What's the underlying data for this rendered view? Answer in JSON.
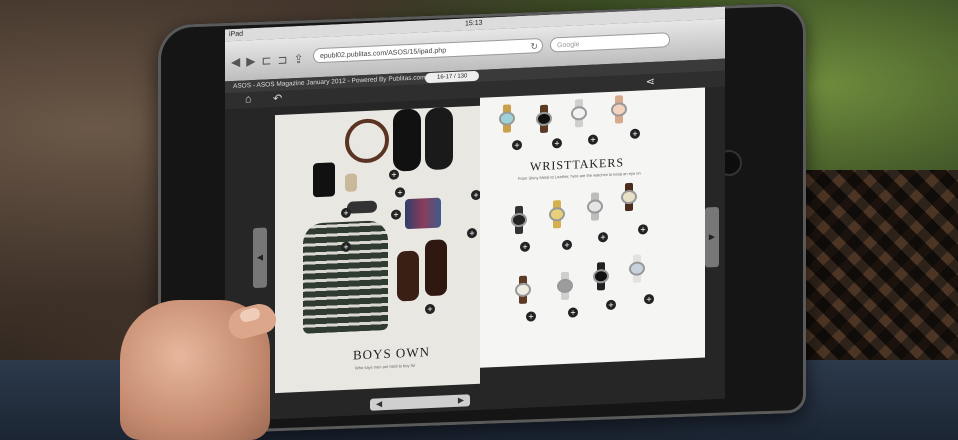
{
  "status_bar": {
    "device": "iPad",
    "time": "15:13",
    "battery": ""
  },
  "browser": {
    "nav_icons": [
      "back-icon",
      "forward-icon",
      "bookmarks-icon",
      "share-icon"
    ],
    "url": "epubl02.publitas.com/ASOS/15/ipad.php",
    "search_placeholder": "Google"
  },
  "reader": {
    "title": "ASOS - ASOS Magazine January 2012 - Powered By Publitas.com",
    "page_indicator": "16-17 / 130",
    "left_page_headline": "BOYS OWN",
    "left_page_sub": "Who says men are hard to buy for",
    "right_page_headline": "WRISTTAKERS",
    "right_page_sub": "From Shiny Metal to Leather, here are the watches to keep an eye on",
    "plus_label": "+"
  },
  "colors": {
    "accent_dark": "#222222",
    "page_bg": "#f5f5f3"
  }
}
